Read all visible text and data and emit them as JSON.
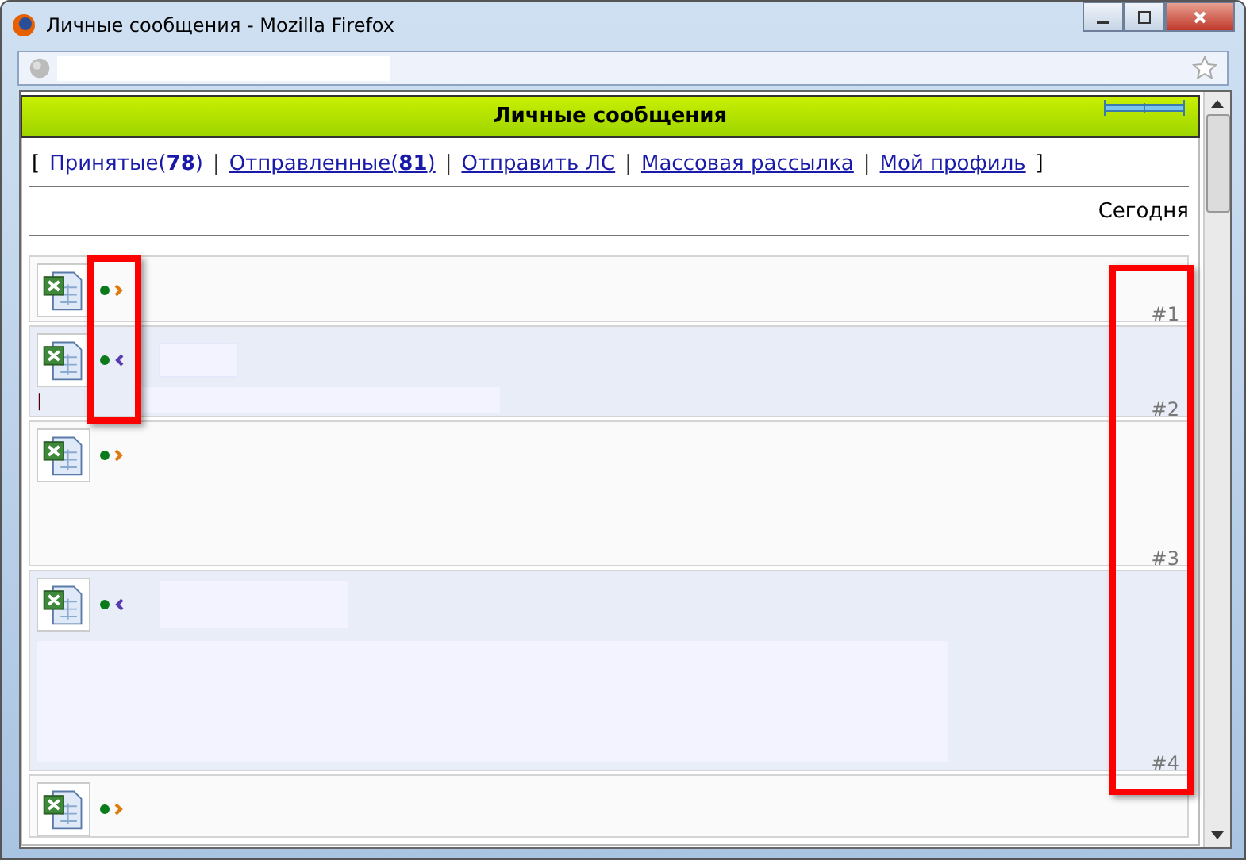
{
  "window": {
    "title": "Личные сообщения - Mozilla Firefox"
  },
  "header": {
    "title": "Личные сообщения"
  },
  "nav": [
    {
      "label": "Принятые(",
      "count": "78",
      "close": ")",
      "link": false
    },
    {
      "label": "Отправленные(",
      "count": "81",
      "close": ")",
      "link": true
    },
    {
      "label": "Отправить ЛС",
      "link": true
    },
    {
      "label": "Массовая рассылка",
      "link": true
    },
    {
      "label": "Мой профиль",
      "link": true
    }
  ],
  "nav_open": "[",
  "nav_sep": "|",
  "nav_end": "]",
  "date": "Сегодня",
  "messages": [
    {
      "kind": "outgoing",
      "number": "#1"
    },
    {
      "kind": "incoming",
      "number": "#2",
      "subject_hidden": true,
      "body": "|"
    },
    {
      "kind": "outgoing",
      "number": "#3"
    },
    {
      "kind": "incoming",
      "number": "#4",
      "subject_hidden": true,
      "body_hidden": true
    },
    {
      "kind": "outgoing"
    }
  ]
}
